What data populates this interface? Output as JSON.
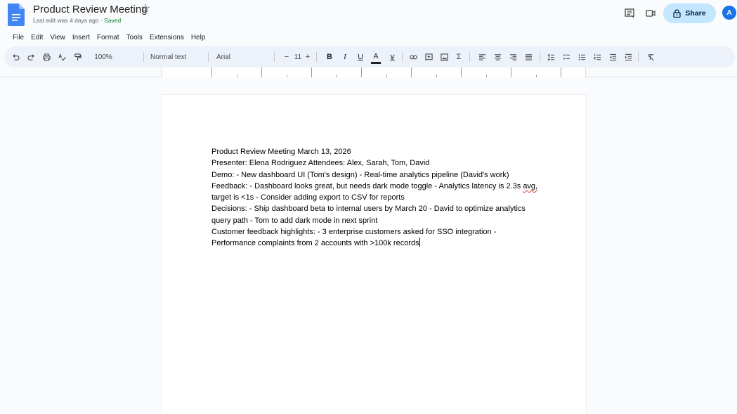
{
  "doc": {
    "title": "Product Review Meeting",
    "last_edit": "Last edit was 4 days ago",
    "separator": "·",
    "saved": "Saved"
  },
  "header": {
    "share_label": "Share",
    "avatar_letter": "A"
  },
  "menu": [
    "File",
    "Edit",
    "View",
    "Insert",
    "Format",
    "Tools",
    "Extensions",
    "Help"
  ],
  "toolbar": {
    "zoom": "100%",
    "style": "Normal text",
    "font": "Arial",
    "decrease": "−",
    "font_size": "11",
    "increase": "+",
    "bold": "B",
    "italic": "I",
    "underline": "U",
    "text_color": "A",
    "icons": [
      "undo-icon",
      "redo-icon",
      "print-icon",
      "spellcheck-icon",
      "paint-format-icon",
      "link-icon",
      "comment-add-icon",
      "image-icon",
      "sigma-icon",
      "align-left-icon",
      "align-center-icon",
      "align-right-icon",
      "justify-icon",
      "line-spacing-icon",
      "checklist-icon",
      "bulleted-list-icon",
      "numbered-list-icon",
      "decrease-indent-icon",
      "increase-indent-icon",
      "clear-formatting-icon"
    ]
  },
  "content": {
    "lines": [
      "Product Review Meeting March 13, 2026",
      "Presenter: Elena Rodriguez Attendees: Alex, Sarah, Tom, David",
      "Demo: - New dashboard UI (Tom's design) - Real-time analytics pipeline (David's work)",
      "Feedback: - Dashboard looks great, but needs dark mode toggle - Analytics latency is 2.3s",
      "target is <1s - Consider adding export to CSV for reports",
      "Decisions: - Ship dashboard beta to internal users by March 20 - David to optimize analytics",
      "query path - Tom to add dark mode in next sprint",
      "Customer feedback highlights: - 3 enterprise customers asked for SSO integration -",
      "Performance complaints from 2 accounts with >100k records"
    ],
    "misspelled_word": "avg,"
  },
  "colors": {
    "accent": "#1a73e8",
    "share_bg": "#c2e7ff",
    "toolbar_bg": "#edf2fa",
    "saved": "#188038"
  }
}
